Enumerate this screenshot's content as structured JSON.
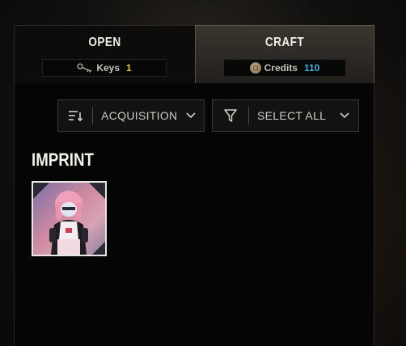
{
  "tabs": {
    "open": {
      "label": "OPEN",
      "currency_label": "Keys",
      "currency_value": "1",
      "icon": "key-icon"
    },
    "craft": {
      "label": "CRAFT",
      "currency_label": "Credits",
      "currency_value": "110",
      "icon": "credits-coin-icon",
      "active": true
    }
  },
  "filters": {
    "sort": {
      "label": "ACQUISITION",
      "icon": "sort-icon"
    },
    "filter": {
      "label": "SELECT ALL",
      "icon": "filter-icon"
    }
  },
  "section": {
    "title": "IMPRINT"
  },
  "items": [
    {
      "name": "imprint-character-portrait"
    }
  ],
  "colors": {
    "keys_value": "#e6c647",
    "credits_value": "#3fb2d8",
    "active_tab_bg": "#3a352e",
    "card_border": "#e9e7e2"
  }
}
